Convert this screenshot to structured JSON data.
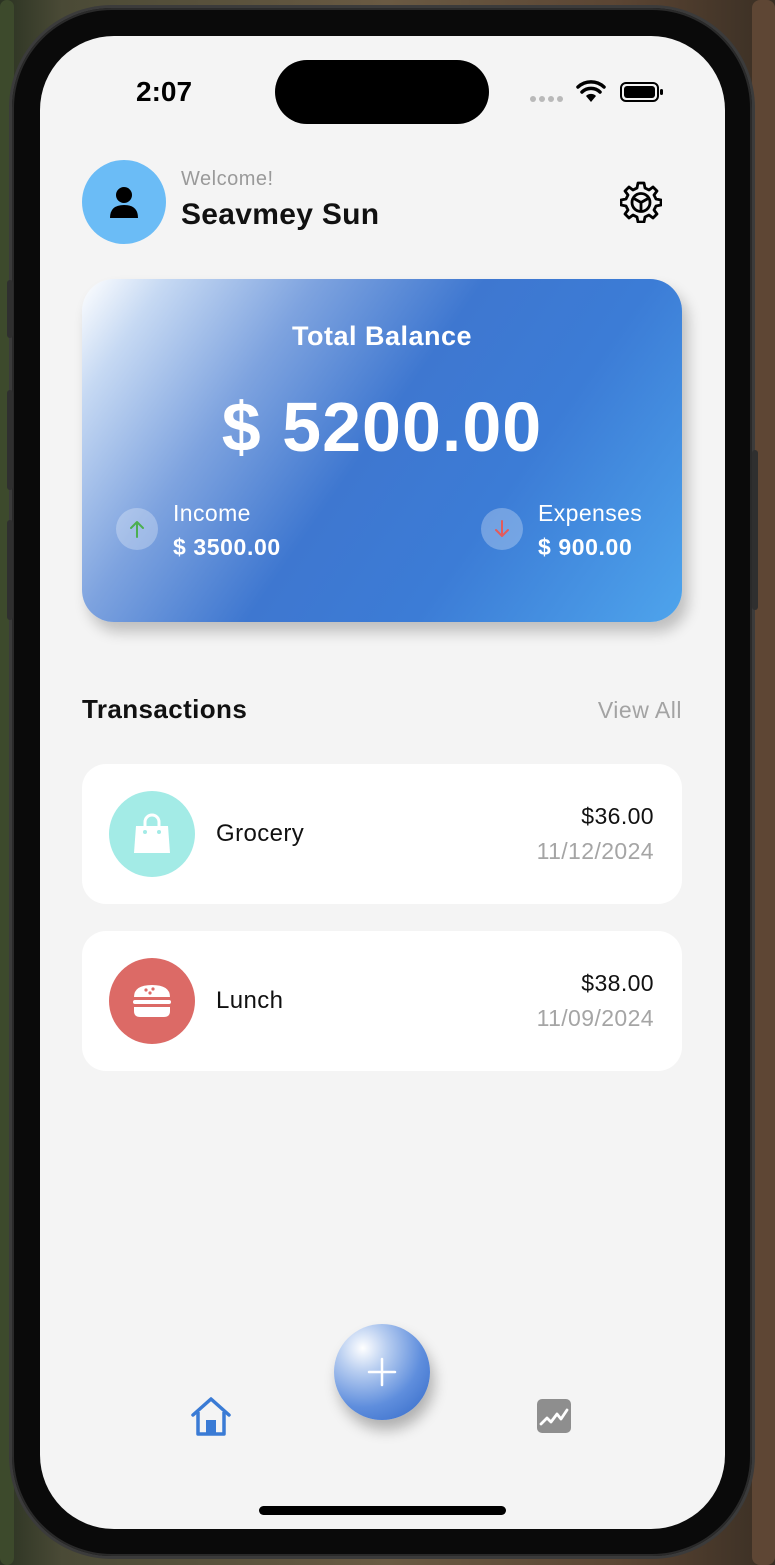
{
  "status_bar": {
    "time": "2:07"
  },
  "header": {
    "welcome": "Welcome!",
    "user_name": "Seavmey Sun",
    "avatar_icon": "person-icon",
    "settings_icon": "gear-icon"
  },
  "balance_card": {
    "title": "Total Balance",
    "amount": "$ 5200.00",
    "income": {
      "label": "Income",
      "value": "$ 3500.00",
      "icon": "arrow-up-icon",
      "color": "#4caf50"
    },
    "expenses": {
      "label": "Expenses",
      "value": "$ 900.00",
      "icon": "arrow-down-icon",
      "color": "#e35b5b"
    }
  },
  "transactions": {
    "title": "Transactions",
    "view_all": "View All",
    "items": [
      {
        "name": "Grocery",
        "amount": "$36.00",
        "date": "11/12/2024",
        "icon": "shopping-bag-icon",
        "color": "#a3ebe6"
      },
      {
        "name": "Lunch",
        "amount": "$38.00",
        "date": "11/09/2024",
        "icon": "burger-icon",
        "color": "#dc6a66"
      }
    ]
  },
  "bottom_nav": {
    "home_icon": "home-icon",
    "add_icon": "plus-icon",
    "stats_icon": "stats-icon",
    "accent": "#3a7bd5"
  }
}
